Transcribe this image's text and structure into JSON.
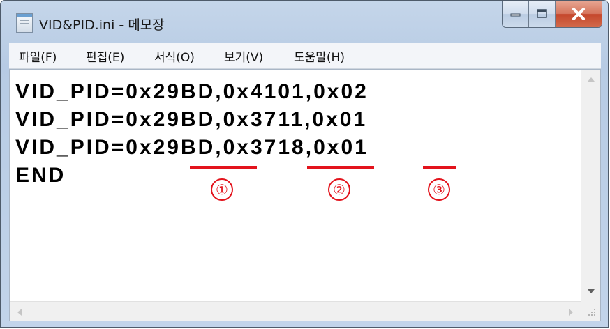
{
  "window": {
    "title": "VID&PID.ini - 메모장"
  },
  "menu": {
    "items": [
      "파일(F)",
      "편집(E)",
      "서식(O)",
      "보기(V)",
      "도움말(H)"
    ]
  },
  "editor": {
    "lines": [
      "VID_PID=0x29BD,0x4101,0x02",
      "VID_PID=0x29BD,0x3711,0x01",
      "VID_PID=0x29BD,0x3718,0x01",
      "END"
    ]
  },
  "annotations": {
    "labels": [
      "①",
      "②",
      "③"
    ],
    "color": "#e3131c"
  },
  "icons": {
    "app": "notepad-icon",
    "minimize": "minimize-icon",
    "maximize": "maximize-icon",
    "close": "close-icon"
  }
}
